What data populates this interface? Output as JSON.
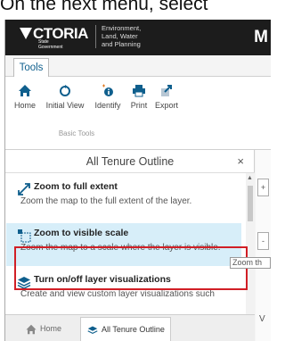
{
  "caption": "On the next menu, select",
  "header": {
    "logo_text": "CTORIA",
    "logo_sub": "State\nGovernment",
    "department_line1": "Environment,",
    "department_line2": "Land, Water",
    "department_line3": "and Planning",
    "right_letter": "M"
  },
  "tabs": {
    "tools_label": "Tools"
  },
  "ribbon": {
    "buttons": [
      {
        "label": "Home",
        "icon": "home-icon"
      },
      {
        "label": "Initial View",
        "icon": "refresh-icon"
      },
      {
        "label": "Identify",
        "icon": "info-icon"
      },
      {
        "label": "Print",
        "icon": "printer-icon"
      },
      {
        "label": "Export",
        "icon": "export-icon"
      }
    ],
    "group_label": "Basic Tools"
  },
  "panel": {
    "title": "All Tenure Outline",
    "close": "×",
    "items": [
      {
        "title": "Zoom to full extent",
        "desc": "Zoom the map to the full extent of the layer."
      },
      {
        "title": "Zoom to visible scale",
        "desc": "Zoom the map to a scale where the layer is visible."
      },
      {
        "title": "Turn on/off layer visualizations",
        "desc": "Create and view custom layer visualizations such"
      }
    ],
    "scroll_up": "▲",
    "scroll_down": "▼"
  },
  "tooltip": "Zoom th",
  "side": {
    "btn1": "+",
    "btn2": "-",
    "letter": "V"
  },
  "bottom_tabs": {
    "home": "Home",
    "outline": "All Tenure Outline"
  },
  "colors": {
    "accent": "#0f5f8d",
    "highlight_border": "#d11f26",
    "selected_bg": "#d7eef9"
  }
}
